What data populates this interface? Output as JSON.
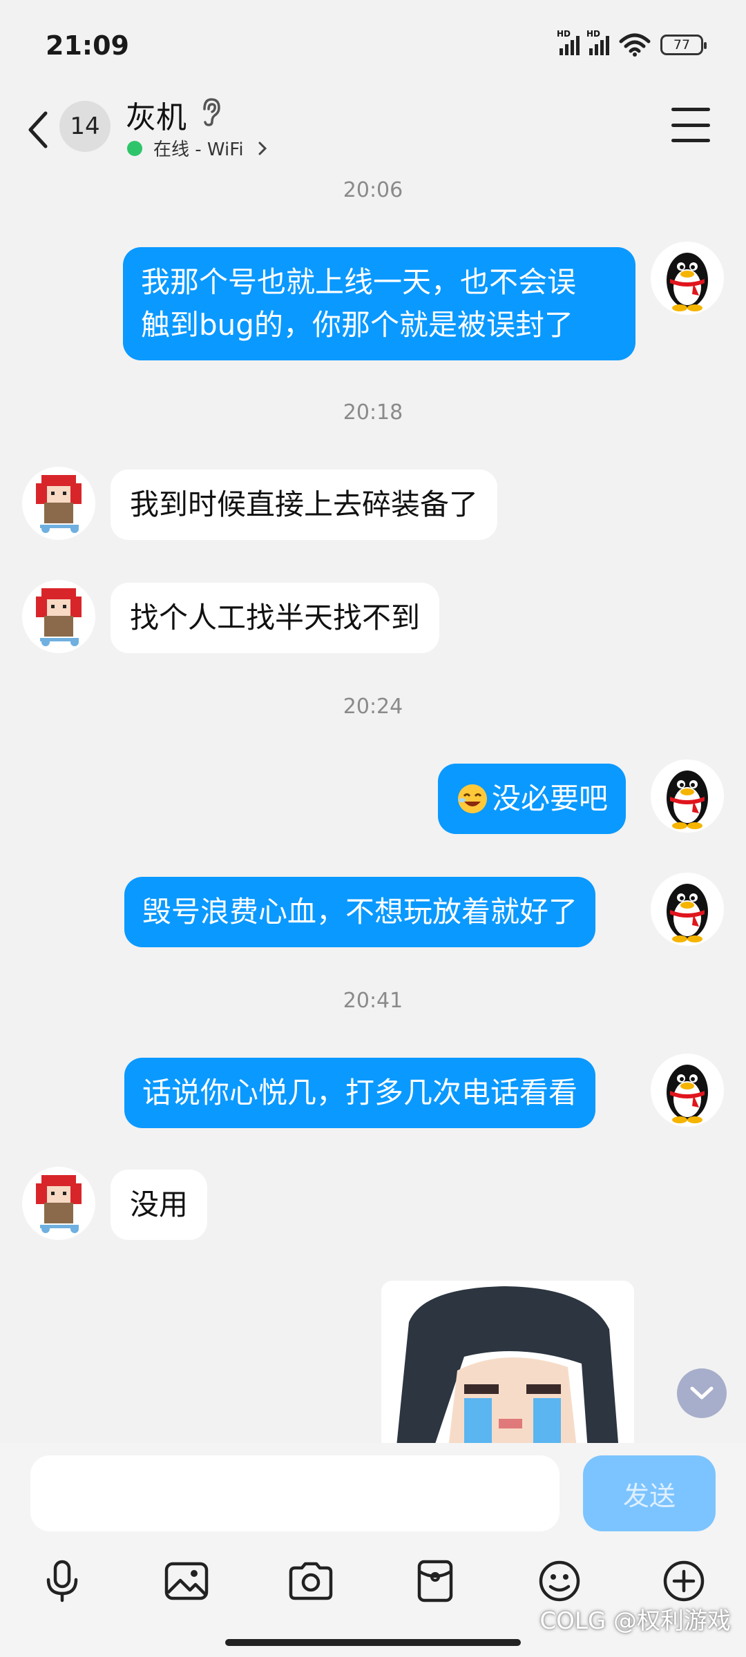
{
  "status_bar": {
    "time": "21:09",
    "battery": "77",
    "sim1": "HD",
    "sim2": "HD"
  },
  "header": {
    "unread_count": "14",
    "contact_name": "灰机",
    "online_status": "在线 - WiFi"
  },
  "messages": {
    "ts1": "20:06",
    "m1": [
      "我那个号也就上线一天，也不会误",
      "触到bug的，你那个就是被误封了"
    ],
    "ts2": "20:18",
    "m2": "我到时候直接上去碎装备了",
    "m3": "找个人工找半天找不到",
    "ts3": "20:24",
    "m4": "没必要吧",
    "m5": "毁号浪费心血，不想玩放着就好了",
    "ts4": "20:41",
    "m6": "话说你心悦几，打多几次电话看看",
    "m7": "没用"
  },
  "input": {
    "value": "",
    "send_label": "发送"
  },
  "toolbar": [
    "microphone-icon",
    "image-icon",
    "camera-icon",
    "red-packet-icon",
    "emoji-icon",
    "plus-icon"
  ],
  "watermark": "COLG @权利游戏",
  "colors": {
    "my_bubble": "#0a99ff",
    "their_bubble": "#ffffff",
    "online": "#2ec56a",
    "send_button": "#7cc4ff"
  }
}
